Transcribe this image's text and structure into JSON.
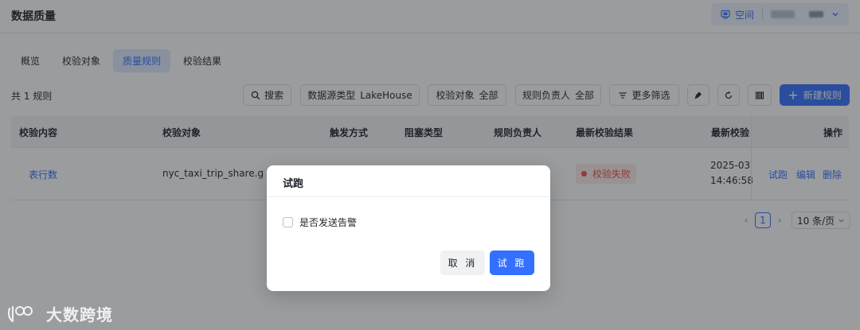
{
  "app": {
    "title": "数据质量",
    "space_label": "空间",
    "colors": {
      "accent": "#3370ff",
      "error": "#f54a45"
    }
  },
  "tabs": [
    {
      "label": "概览",
      "active": false
    },
    {
      "label": "校验对象",
      "active": false
    },
    {
      "label": "质量规则",
      "active": true
    },
    {
      "label": "校验结果",
      "active": false
    }
  ],
  "toolbar": {
    "count_text": "共 1 规则",
    "search_label": "搜索",
    "datasource_label": "数据源类型",
    "datasource_value": "LakeHouse",
    "target_label": "校验对象",
    "target_value": "全部",
    "owner_label": "规则负责人",
    "owner_value": "全部",
    "more_filters_label": "更多筛选",
    "new_rule_label": "新建规则"
  },
  "table": {
    "columns": [
      "校验内容",
      "校验对象",
      "触发方式",
      "阻塞类型",
      "规则负责人",
      "最新校验结果",
      "最新校验",
      "操作"
    ],
    "rows": [
      {
        "content": "表行数",
        "target": "nyc_taxi_trip_share.g",
        "result": "校验失败",
        "last_date": "2025-03",
        "last_time": "14:46:58",
        "actions": [
          "试跑",
          "编辑",
          "删除"
        ]
      }
    ]
  },
  "pagination": {
    "current_page": "1",
    "page_size": "10 条/页"
  },
  "modal": {
    "title": "试跑",
    "checkbox_label": "是否发送告警",
    "checkbox_checked": false,
    "cancel_label": "取 消",
    "confirm_label": "试 跑"
  },
  "watermark": {
    "text": "大数跨境"
  }
}
